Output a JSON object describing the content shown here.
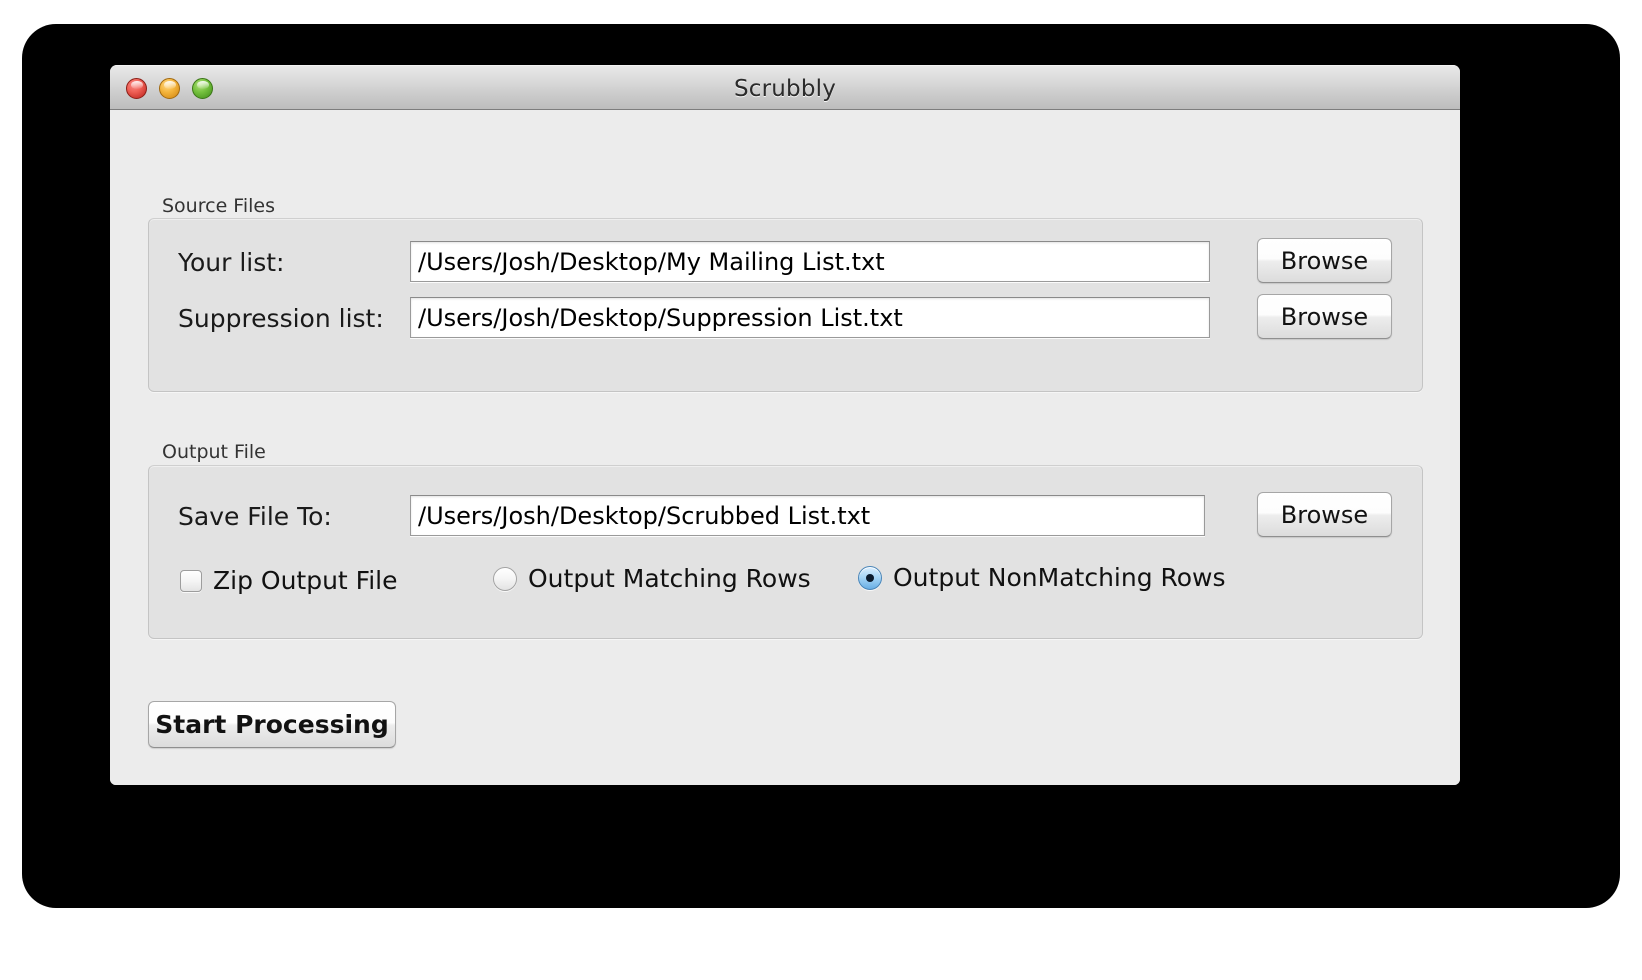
{
  "window": {
    "title": "Scrubbly",
    "traffic_lights": {
      "close": "close-button",
      "minimize": "minimize-button",
      "maximize": "maximize-button"
    },
    "colors": {
      "close": "#ee5f55",
      "minimize": "#f4b53d",
      "maximize": "#76c23f",
      "window_background": "#ececec",
      "group_background": "#e2e2e2",
      "titlebar": "#d5d5d5",
      "radio_selected": "#69aee4",
      "backdrop": "#000000"
    }
  },
  "source_files": {
    "group_label": "Source Files",
    "rows": [
      {
        "label": "Your list:",
        "value": "/Users/Josh/Desktop/My Mailing List.txt",
        "placeholder": "",
        "button": "Browse"
      },
      {
        "label": "Suppression list:",
        "value": "/Users/Josh/Desktop/Suppression List.txt",
        "placeholder": "",
        "button": "Browse"
      }
    ]
  },
  "output_file": {
    "group_label": "Output File",
    "row": {
      "label": "Save File To:",
      "value": "/Users/Josh/Desktop/Scrubbed List.txt",
      "placeholder": "",
      "button": "Browse"
    },
    "options": {
      "zip": {
        "label": "Zip Output File",
        "checked": false
      },
      "radios": [
        {
          "label": "Output Matching Rows",
          "selected": false
        },
        {
          "label": "Output NonMatching Rows",
          "selected": true
        }
      ]
    }
  },
  "actions": {
    "start_label": "Start Processing"
  }
}
